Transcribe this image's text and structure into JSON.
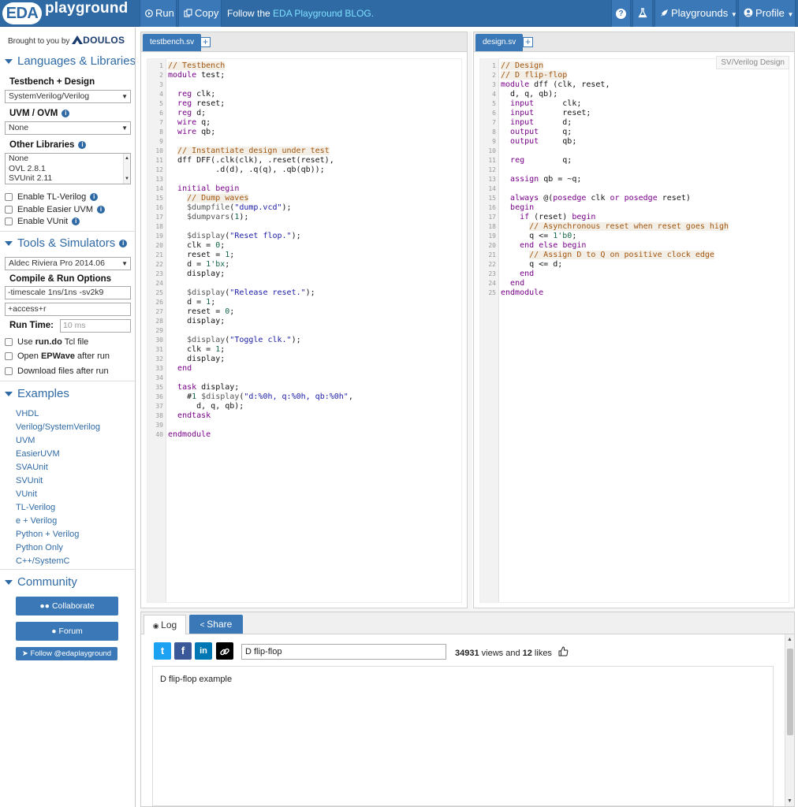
{
  "header": {
    "logo_badge": "EDA",
    "logo_text": "playground",
    "run_label": "Run",
    "copy_label": "Copy",
    "follow_prefix": "Follow the ",
    "follow_link": "EDA Playground BLOG.",
    "help_icon": "?",
    "playgrounds_label": "Playgrounds",
    "profile_label": "Profile"
  },
  "sidebar": {
    "brought_by": "Brought to you by",
    "doulos": "DOULOS",
    "languages_heading": "Languages & Libraries",
    "testbench_design_label": "Testbench + Design",
    "testbench_design_value": "SystemVerilog/Verilog",
    "uvm_label": "UVM / OVM",
    "uvm_value": "None",
    "other_libs_label": "Other Libraries",
    "other_libs": [
      "None",
      "OVL 2.8.1",
      "SVUnit 2.11"
    ],
    "checks": [
      "Enable TL-Verilog",
      "Enable Easier UVM",
      "Enable VUnit"
    ],
    "tools_heading": "Tools & Simulators",
    "simulator_value": "Aldec Riviera Pro 2014.06",
    "compile_label": "Compile & Run Options",
    "compile_opts": "-timescale 1ns/1ns -sv2k9",
    "run_opts": "+access+r",
    "run_time_label": "Run Time:",
    "run_time_placeholder": "10 ms",
    "use_run_pre": "Use ",
    "use_run_bold": "run.do",
    "use_run_post": " Tcl file",
    "open_ep_pre": "Open ",
    "open_ep_bold": "EPWave",
    "open_ep_post": " after run",
    "download": "Download files after run",
    "examples_heading": "Examples",
    "examples": [
      "VHDL",
      "Verilog/SystemVerilog",
      "UVM",
      "EasierUVM",
      "SVAUnit",
      "SVUnit",
      "VUnit",
      "TL-Verilog",
      "e + Verilog",
      "Python + Verilog",
      "Python Only",
      "C++/SystemC"
    ],
    "community_heading": "Community",
    "collaborate": "Collaborate",
    "forum": "Forum",
    "follow_twitter": "Follow @edaplayground"
  },
  "left_pane": {
    "tab": "testbench.sv",
    "plus": "+"
  },
  "right_pane": {
    "tab": "design.sv",
    "plus": "+",
    "tag": "SV/Verilog Design"
  },
  "testbench_code": [
    "// Testbench",
    "module test;",
    "",
    "  reg clk;",
    "  reg reset;",
    "  reg d;",
    "  wire q;",
    "  wire qb;",
    "",
    "  // Instantiate design under test",
    "  dff DFF(.clk(clk), .reset(reset),",
    "          .d(d), .q(q), .qb(qb));",
    "",
    "  initial begin",
    "    // Dump waves",
    "    $dumpfile(\"dump.vcd\");",
    "    $dumpvars(1);",
    "",
    "    $display(\"Reset flop.\");",
    "    clk = 0;",
    "    reset = 1;",
    "    d = 1'bx;",
    "    display;",
    "",
    "    $display(\"Release reset.\");",
    "    d = 1;",
    "    reset = 0;",
    "    display;",
    "",
    "    $display(\"Toggle clk.\");",
    "    clk = 1;",
    "    display;",
    "  end",
    "",
    "  task display;",
    "    #1 $display(\"d:%0h, q:%0h, qb:%0h\",",
    "      d, q, qb);",
    "  endtask",
    "",
    "endmodule"
  ],
  "design_code": [
    "// Design",
    "// D flip-flop",
    "module dff (clk, reset,",
    "  d, q, qb);",
    "  input      clk;",
    "  input      reset;",
    "  input      d;",
    "  output     q;",
    "  output     qb;",
    "",
    "  reg        q;",
    "",
    "  assign qb = ~q;",
    "",
    "  always @(posedge clk or posedge reset)",
    "  begin",
    "    if (reset) begin",
    "      // Asynchronous reset when reset goes high",
    "      q <= 1'b0;",
    "    end else begin",
    "      // Assign D to Q on positive clock edge",
    "      q <= d;",
    "    end",
    "  end",
    "endmodule"
  ],
  "bottom": {
    "log_tab": "Log",
    "share_tab": "Share",
    "twitter": "t",
    "facebook": "f",
    "linkedin": "in",
    "title_value": "D flip-flop",
    "views_count": "34931",
    "views_mid": " views and ",
    "likes_count": "12",
    "likes_suffix": " likes",
    "description": "D flip-flop example"
  }
}
